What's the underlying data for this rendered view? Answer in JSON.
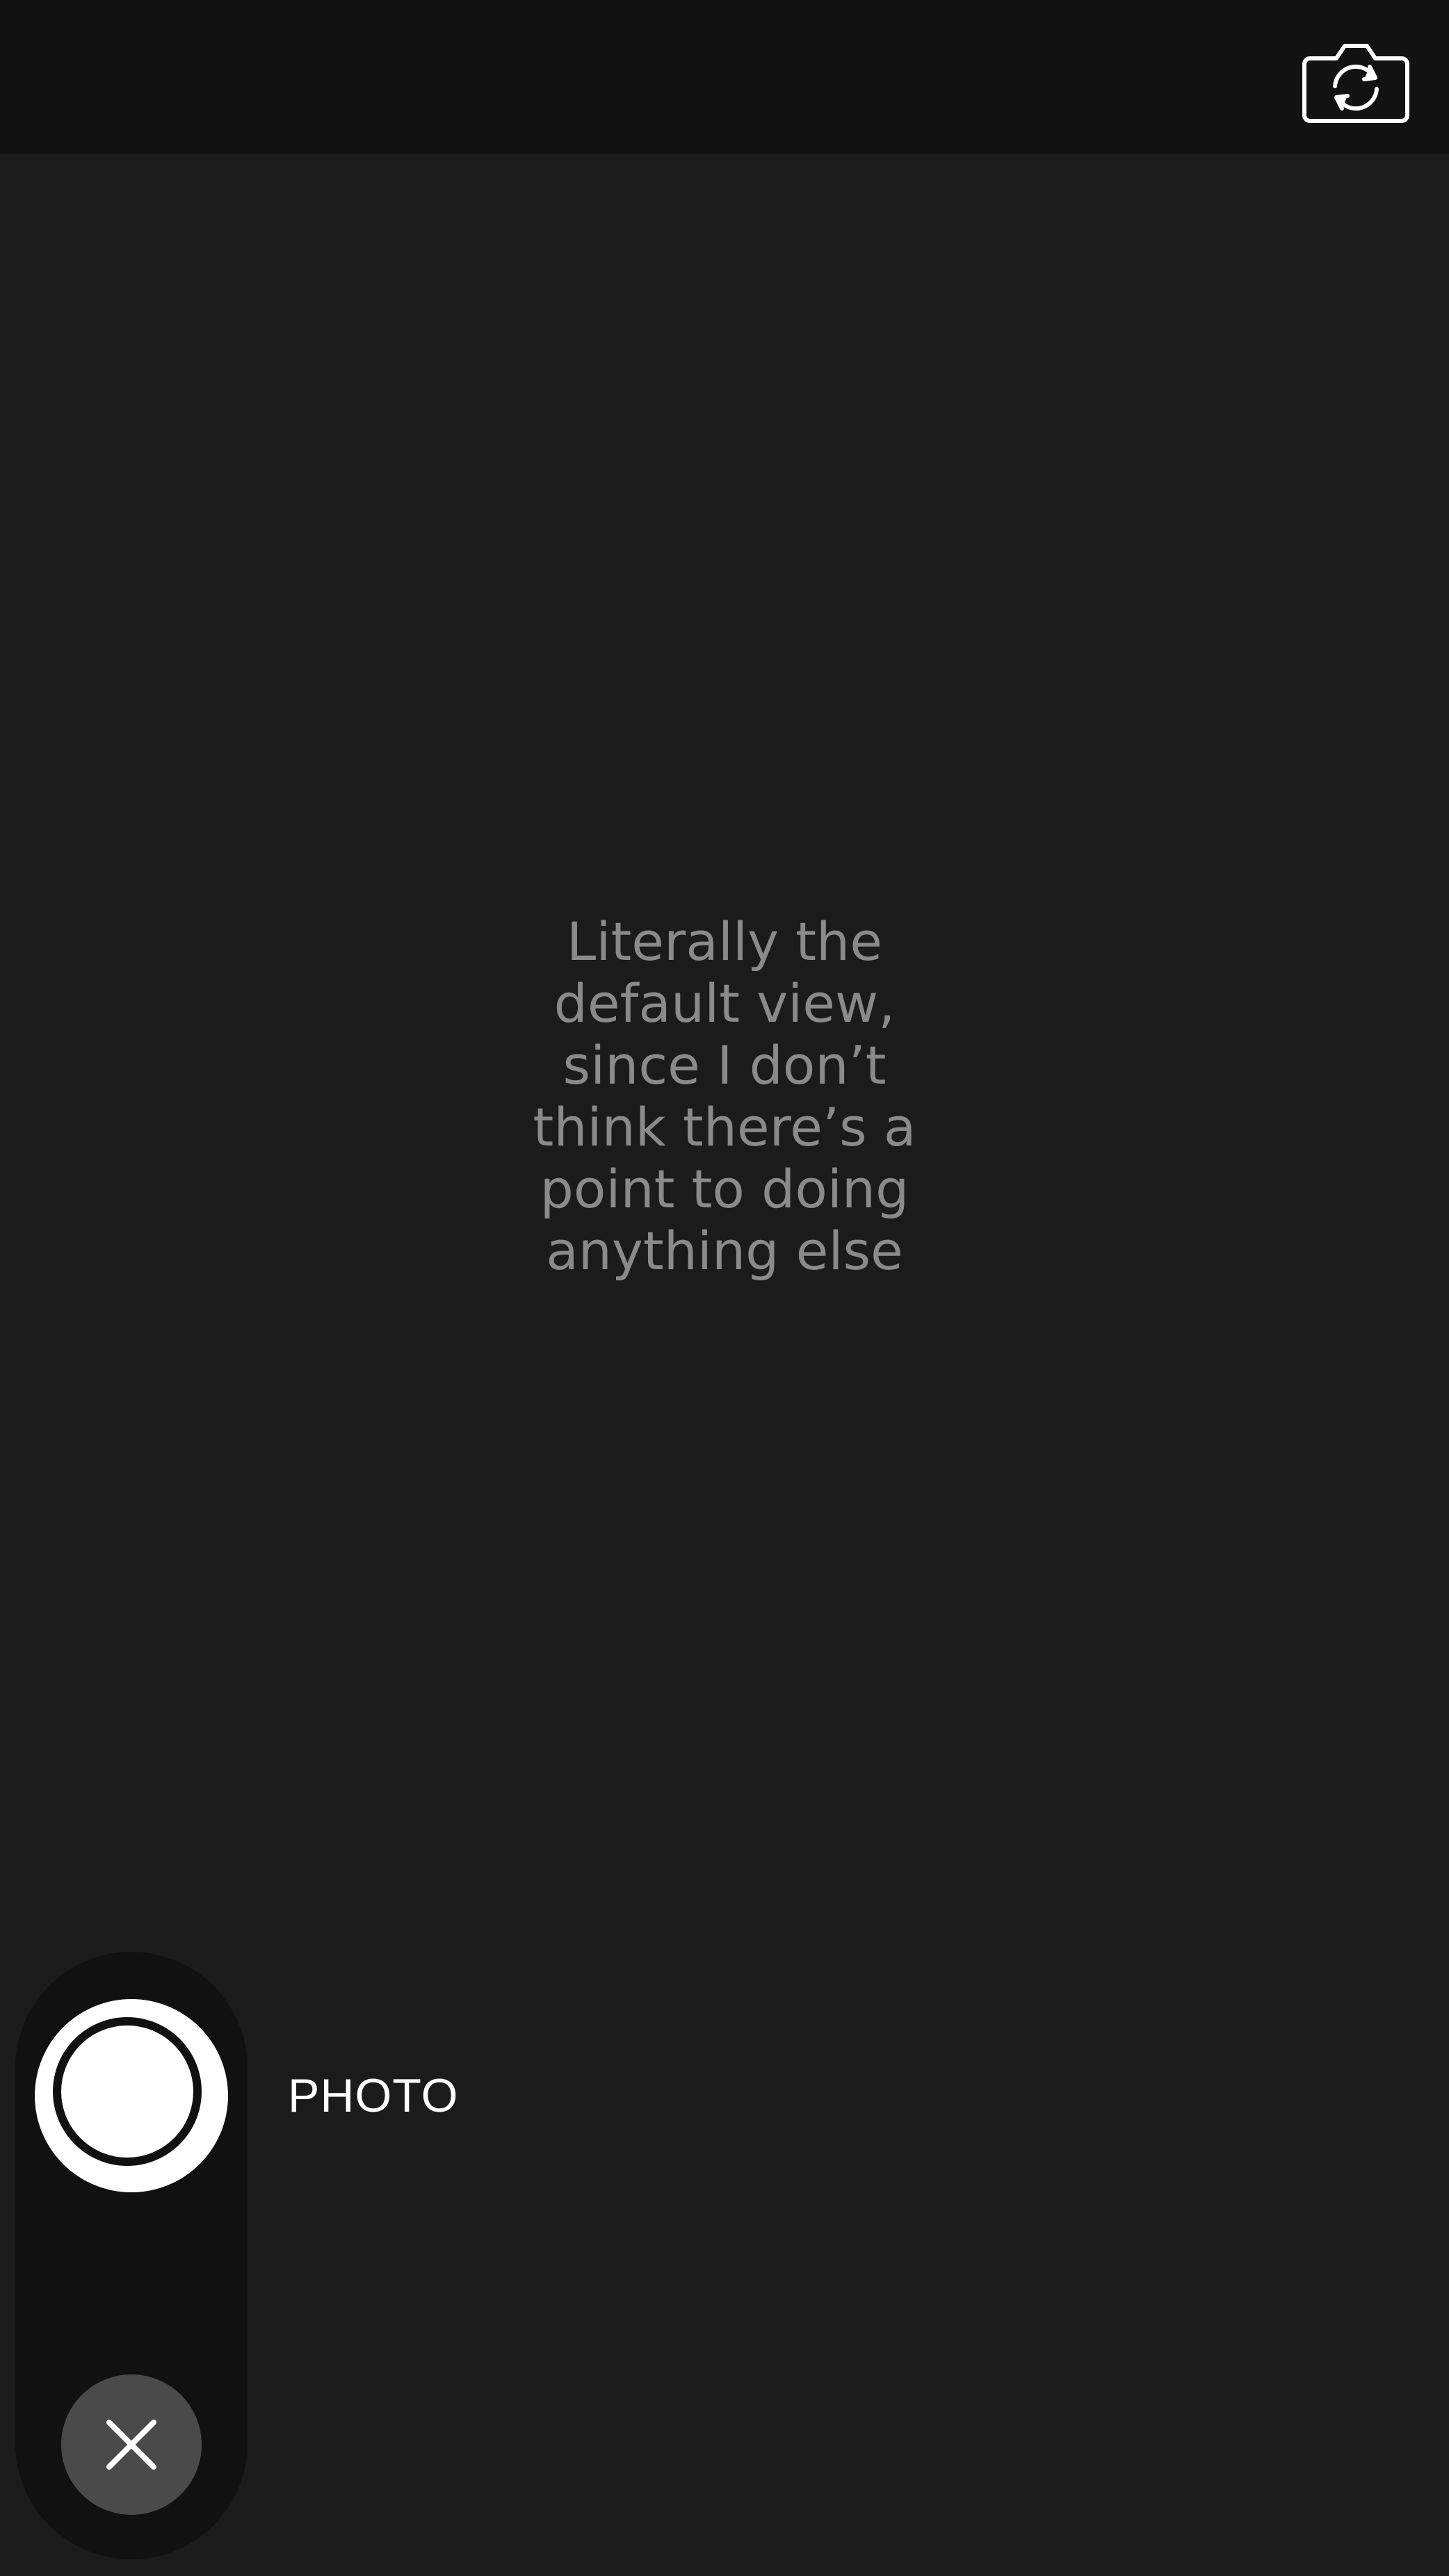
{
  "top_bar": {
    "flip_camera_icon": "camera-flip-icon"
  },
  "viewfinder": {
    "placeholder_text": "Literally the\ndefault view,\nsince I don’t\nthink there’s a\npoint to doing\nanything else"
  },
  "controls": {
    "mode_label": "PHOTO",
    "shutter_icon": "shutter-icon",
    "close_icon": "close-icon"
  },
  "colors": {
    "background": "#1b1b1b",
    "top_bar": "#121212",
    "placeholder_text": "#8a8a8a",
    "control_pill": "#111111",
    "close_button": "#4a4a4a",
    "shutter": "#ffffff"
  }
}
